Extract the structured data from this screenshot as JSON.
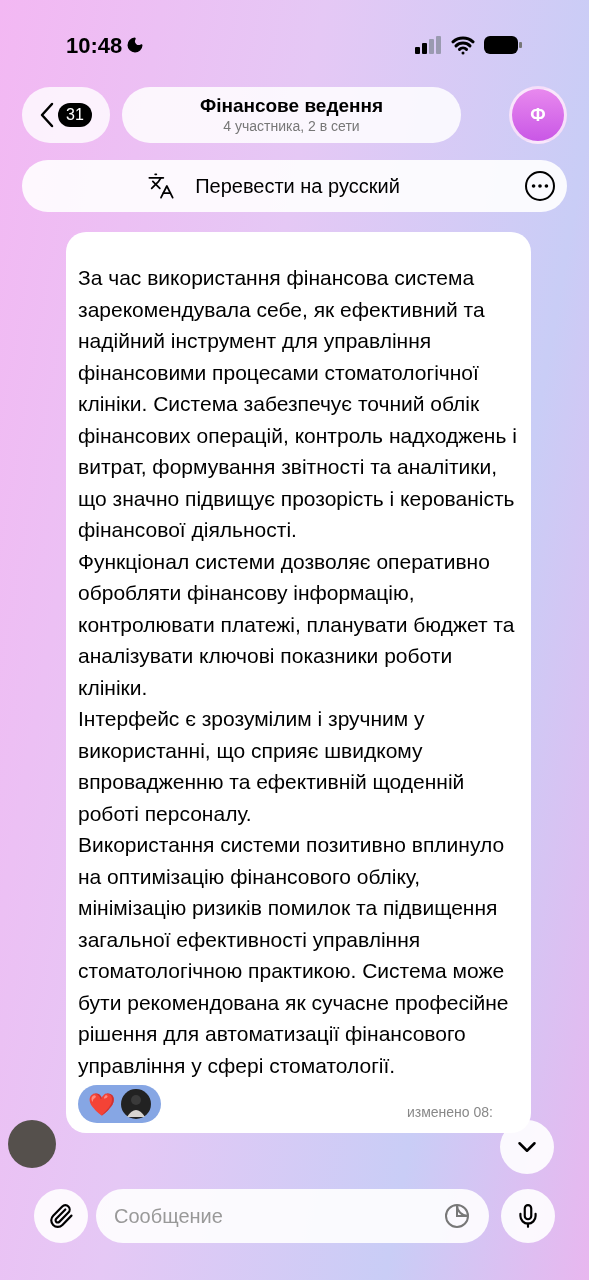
{
  "status_bar": {
    "time": "10:48"
  },
  "header": {
    "back_count": "31",
    "title": "Фінансове ведення",
    "subtitle": "4 участника, 2 в сети",
    "avatar_letter": "Ф"
  },
  "translate_bar": {
    "label": "Перевести на русский"
  },
  "message": {
    "paragraphs": [
      "За час використання фінансова система зарекомендувала себе, як ефективний та надійний інструмент для управління фінансовими процесами стоматологічної клініки. Система забезпечує точний облік фінансових операцій, контроль надходжень і витрат, формування звітності та аналітики, що значно підвищує прозорість і керованість фінансової діяльності.",
      "Функціонал системи дозволяє оперативно обробляти фінансову інформацію, контролювати платежі, планувати бюджет та аналізувати ключові показники роботи клініки.",
      "Інтерфейс є зрозумілим і зручним у використанні, що сприяє швидкому впровадженню та ефективній щоденній роботі персоналу.",
      "Використання системи позитивно вплинуло на оптимізацію фінансового обліку, мінімізацію ризиків помилок та підвищення загальної ефективності управління стоматологічною практикою. Система може бути рекомендована як сучасне професійне рішення для автоматизації фінансового управління у сфері стоматології."
    ],
    "reaction": "❤️",
    "edited": "изменено 08:"
  },
  "composer": {
    "placeholder": "Сообщение"
  }
}
